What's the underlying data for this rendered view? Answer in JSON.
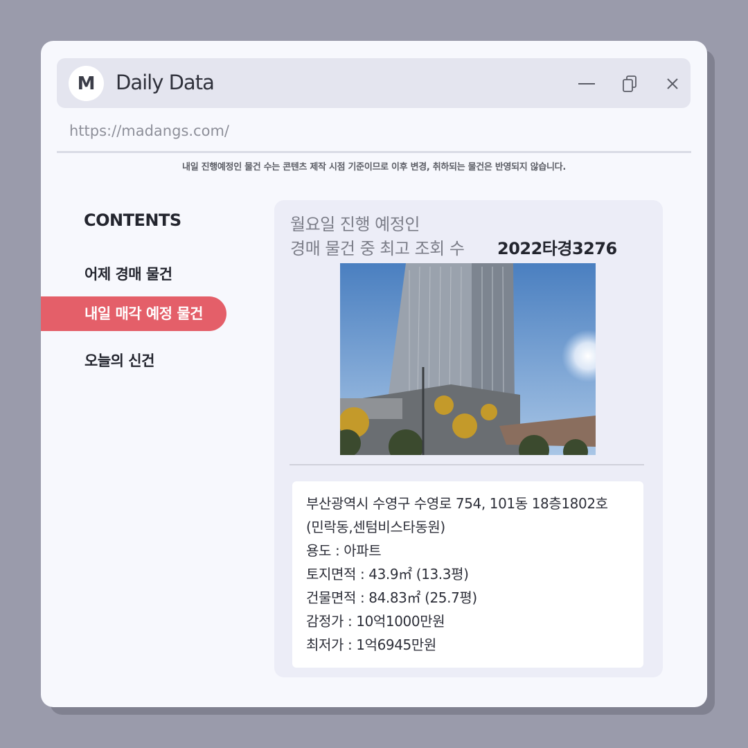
{
  "app": {
    "avatar_letter": "M",
    "title": "Daily Data",
    "url": "https://madangs.com/"
  },
  "notice": "내일 진행예정인 물건 수는 콘텐츠 제작 시점 기준이므로 이후 변경, 취하되는 물건은 반영되지 않습니다.",
  "sidebar": {
    "heading": "CONTENTS",
    "items": [
      {
        "label": "어제 경매 물건",
        "active": false
      },
      {
        "label": "내일 매각 예정 물건",
        "active": true
      },
      {
        "label": "오늘의 신건",
        "active": false
      }
    ]
  },
  "card": {
    "heading_line1": "월요일 진행 예정인",
    "heading_line2": "경매 물건 중 최고 조회 수",
    "case_number": "2022타경3276",
    "address_line1": "부산광역시 수영구 수영로 754, 101동 18층1802호",
    "address_line2": "(민락동,센텀비스타동원)",
    "usage": "용도 : 아파트",
    "land_area": "토지면적 : 43.9㎡ (13.3평)",
    "building_area": "건물면적 : 84.83㎡ (25.7평)",
    "appraised_price": "감정가 : 10억1000만원",
    "minimum_price": "최저가 : 1억6945만원"
  },
  "colors": {
    "accent": "#e45f69",
    "background": "#9a9bab",
    "window": "#f7f8fd",
    "titlebar": "#e4e5ef"
  },
  "icons": {
    "minimize": "minimize-icon",
    "restore": "copy-icon",
    "close": "close-icon"
  }
}
